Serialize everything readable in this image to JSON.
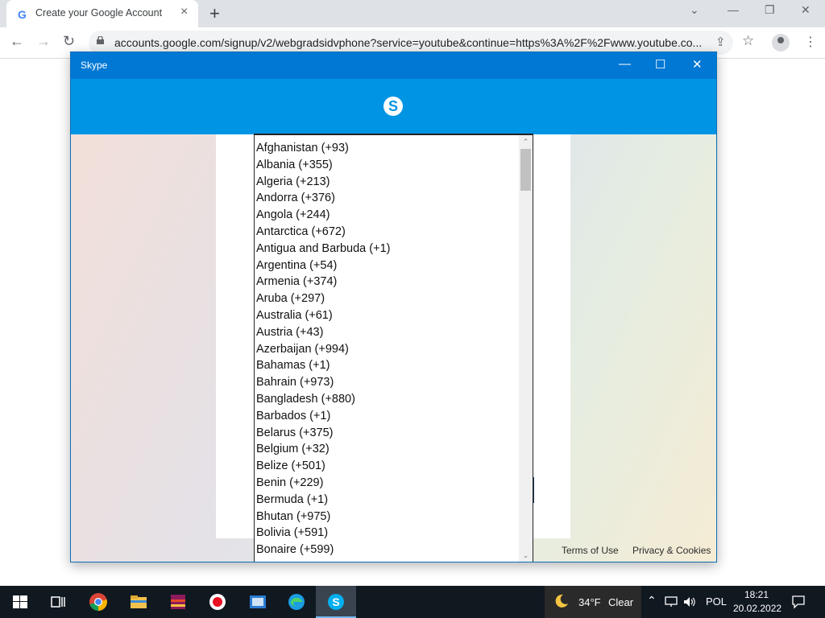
{
  "browser": {
    "tab_title": "Create your Google Account",
    "tab_icon": "G",
    "url": "accounts.google.com/signup/v2/webgradsidvphone?service=youtube&continue=https%3A%2F%2Fwww.youtube.co...",
    "icons": {
      "close_tab": "×",
      "new_tab": "+",
      "back": "←",
      "forward": "→",
      "reload": "↻",
      "share": "⇪",
      "bookmark": "☆",
      "menu": "⋮",
      "tabs_dropdown": "⌄",
      "minimize": "—",
      "restore": "❐",
      "close": "✕"
    }
  },
  "skype": {
    "title": "Skype",
    "logo": "S",
    "controls": {
      "minimize": "—",
      "maximize": "☐",
      "close": "✕"
    },
    "footer": {
      "terms": "Terms of Use",
      "privacy": "Privacy & Cookies"
    },
    "dropdown": {
      "items": [
        "Afghanistan (+93)",
        "Albania (+355)",
        "Algeria (+213)",
        "Andorra (+376)",
        "Angola (+244)",
        "Antarctica (+672)",
        "Antigua and Barbuda (+1)",
        "Argentina (+54)",
        "Armenia (+374)",
        "Aruba (+297)",
        "Australia (+61)",
        "Austria (+43)",
        "Azerbaijan (+994)",
        "Bahamas (+1)",
        "Bahrain (+973)",
        "Bangladesh (+880)",
        "Barbados (+1)",
        "Belarus (+375)",
        "Belgium (+32)",
        "Belize (+501)",
        "Benin (+229)",
        "Bermuda (+1)",
        "Bhutan (+975)",
        "Bolivia (+591)",
        "Bonaire (+599)"
      ],
      "scroll_up": "⌃",
      "scroll_down": "⌄"
    }
  },
  "taskbar": {
    "weather_temp": "34°F",
    "weather_desc": "Clear",
    "language": "POL",
    "time": "18:21",
    "date": "20.02.2022",
    "icons": [
      "windows-start-icon",
      "task-view-icon",
      "chrome-icon",
      "file-explorer-icon",
      "winrar-icon",
      "record-icon",
      "app-icon",
      "edge-icon",
      "skype-icon"
    ]
  }
}
